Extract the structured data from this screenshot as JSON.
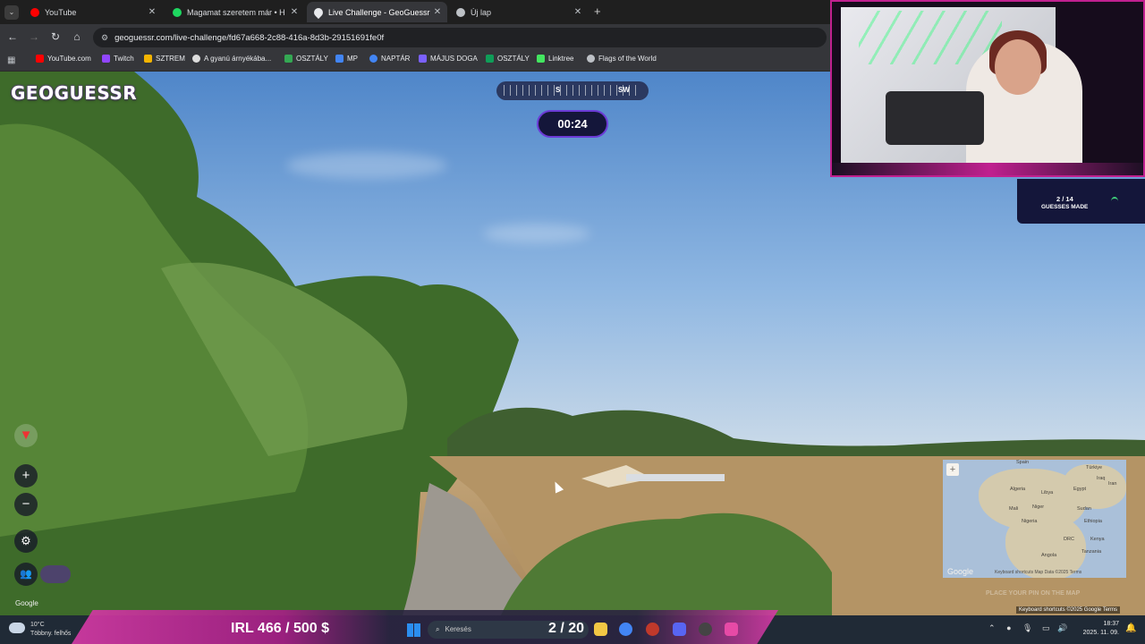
{
  "browser": {
    "tabs": [
      {
        "title": "YouTube",
        "favicon_color": "#ff0000",
        "active": false
      },
      {
        "title": "Magamat szeretem már • H",
        "favicon_color": "#1ed760",
        "active": false
      },
      {
        "title": "Live Challenge - GeoGuessr",
        "favicon_color": "#e8eaed",
        "active": true
      },
      {
        "title": "Új lap",
        "favicon_color": "#bdc1c6",
        "active": false
      }
    ],
    "new_tab_icon": "+",
    "url": "geoguessr.com/live-challenge/fd67a668-2c88-416a-8d3b-29151691fe0f",
    "bookmarks": [
      {
        "label": "YouTube.com",
        "color": "#ff0000"
      },
      {
        "label": "Twitch",
        "color": "#9146ff"
      },
      {
        "label": "SZTREM",
        "color": "#f4b400"
      },
      {
        "label": "A gyanú árnyékába...",
        "color": "#ffffff"
      },
      {
        "label": "OSZTÁLY",
        "color": "#34a853"
      },
      {
        "label": "MP",
        "color": "#4285f4"
      },
      {
        "label": "NAPTÁR",
        "color": "#4285f4"
      },
      {
        "label": "MÁJUS DOGA",
        "color": "#7b61ff"
      },
      {
        "label": "OSZTÁLY",
        "color": "#0f9d58"
      },
      {
        "label": "Linktree",
        "color": "#43e660"
      },
      {
        "label": "Flags of the World",
        "color": "#bdc1c6"
      }
    ]
  },
  "game": {
    "logo": "GEOGUESSR",
    "compass": {
      "left": "S",
      "right": "SW"
    },
    "timer": "00:24",
    "zoom_in": "+",
    "zoom_out": "−",
    "map_labels": [
      "Spain",
      "Türkiye",
      "Algeria",
      "Libya",
      "Egypt",
      "Iraq",
      "Iran",
      "Mali",
      "Niger",
      "Sudan",
      "Nigeria",
      "Ethiopia",
      "DRC",
      "Kenya",
      "Tanzania",
      "Angola"
    ],
    "map_footer": "Keyboard shortcuts  Map Data ©2025  Terms",
    "place_pin": "PLACE YOUR PIN ON THE MAP",
    "google": "Google",
    "keyboard_shortcuts": "Keyboard shortcuts   ©2025 Google   Terms"
  },
  "stream": {
    "guesses_count": "2 / 14",
    "guesses_label": "GUESSES MADE",
    "irl": "IRL  466 / 500 $",
    "round": "2 / 20"
  },
  "taskbar": {
    "weather_temp": "10°C",
    "weather_desc": "Többny. felhős",
    "search": "Keresés",
    "time": "18:37",
    "date": "2025. 11. 09."
  }
}
